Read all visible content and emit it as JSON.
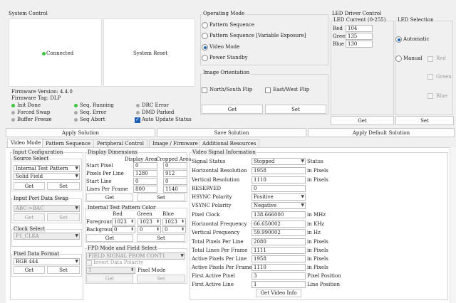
{
  "colors": {
    "green": "#3cc43c",
    "gray": "#a8a8a8",
    "accent": "#1a5fb4"
  },
  "system_control": {
    "title": "System Control",
    "connected_label": "Connected",
    "reset_label": "System Reset",
    "firmware_version": "Firmware Version: 4.4.0",
    "firmware_tag": "Firmware Tag: DLP",
    "status": [
      {
        "label": "Init Done",
        "color": "green"
      },
      {
        "label": "Forced Swap",
        "color": "gray"
      },
      {
        "label": "Buffer Freeze",
        "color": "gray"
      },
      {
        "label": "Seq. Running",
        "color": "green"
      },
      {
        "label": "Seq. Error",
        "color": "gray"
      },
      {
        "label": "Seq Abort",
        "color": "gray"
      },
      {
        "label": "DRC Error",
        "color": "gray"
      },
      {
        "label": "DMD Parked",
        "color": "gray"
      }
    ],
    "auto_update_label": "Auto Update Status"
  },
  "operating_mode": {
    "title": "Operating Mode",
    "options": [
      "Pattern Sequence",
      "Pattern Sequence [Variable Exposure]",
      "Video Mode",
      "Power Standby"
    ],
    "selected": "Video Mode"
  },
  "image_orientation": {
    "title": "Image Orientation",
    "ns_flip": "North/South Flip",
    "ew_flip": "East/West Flip",
    "get": "Get",
    "set": "Set"
  },
  "led_driver": {
    "title": "LED Driver Control",
    "current_title": "LED Current (0-255)",
    "red_label": "Red",
    "red_value": "104",
    "green_label": "Green",
    "green_value": "135",
    "blue_label": "Blue",
    "blue_value": "130",
    "get": "Get",
    "set": "Set"
  },
  "led_selection": {
    "title": "LED Selection",
    "automatic": "Automatic",
    "manual": "Manual",
    "red": "Red",
    "green": "Green",
    "blue": "Blue"
  },
  "toolbar": {
    "apply_solution": "Apply Solution",
    "save_solution": "Save Solution",
    "apply_default": "Apply Default Solution"
  },
  "tabs": [
    "Video Mode",
    "Pattern Sequence",
    "Peripheral Control",
    "Image / Firmware",
    "Additional Resources"
  ],
  "input_config": {
    "title": "Input Configuration",
    "source_select": "Source Select",
    "source_value": "Internal Test Pattern",
    "pattern_value": "Solid Field",
    "port_swap": "Input Port Data Swap",
    "port_swap_value": "ABC->BAC",
    "clock_select": "Clock Select",
    "clock_value": "P1_CLKA",
    "pixel_format": "Pixel Data Format",
    "pixel_format_value": "RGB 444",
    "get": "Get",
    "set": "Set"
  },
  "display_dimensions": {
    "title": "Display Dimensions",
    "col_display": "Display Area",
    "col_cropped": "Cropped Area",
    "rows": [
      {
        "label": "Start Pixel",
        "display": "0",
        "cropped": "0"
      },
      {
        "label": "Pixels Per Line",
        "display": "1280",
        "cropped": "912"
      },
      {
        "label": "Start Line",
        "display": "0",
        "cropped": "0"
      },
      {
        "label": "Lines Per Frame",
        "display": "800",
        "cropped": "1140"
      }
    ],
    "get": "Get",
    "set": "Set"
  },
  "test_pattern_color": {
    "title": "Internal Test Pattern Color",
    "col_red": "Red",
    "col_green": "Green",
    "col_blue": "Blue",
    "foreground": "Foreground",
    "fg": [
      "1023",
      "1023",
      "1023"
    ],
    "background": "Background",
    "bg": [
      "0",
      "0",
      "0"
    ],
    "get": "Get",
    "set": "Set"
  },
  "fpd": {
    "title": "FPD Mode and Field Select",
    "field_value": "FIELD SIGNAL FROM CONT1",
    "invert": "Invert Data Polarity",
    "pixel_mode_value": "1",
    "pixel_mode": "Pixel Mode",
    "get": "Get",
    "set": "Set"
  },
  "video_signal": {
    "title": "Video Signal Information",
    "rows": [
      {
        "label": "Signal Status",
        "value": "Stopped",
        "unit": "Status",
        "dropdown": true
      },
      {
        "label": "Horizontal Resolution",
        "value": "1958",
        "unit": "in Pixels"
      },
      {
        "label": "Vertical Resolution",
        "value": "1110",
        "unit": "in Pixels"
      },
      {
        "label": "RESERVED",
        "value": "0",
        "unit": ""
      },
      {
        "label": "HSYNC Polarity",
        "value": "Positive",
        "unit": "",
        "dropdown": true
      },
      {
        "label": "VSYNC Polarity",
        "value": "Negative",
        "unit": "",
        "dropdown": true
      },
      {
        "label": "Pixel Clock",
        "value": "138.666000",
        "unit": "in MHz"
      },
      {
        "label": "Horizontal Frequency",
        "value": "66.650002",
        "unit": "in KHz"
      },
      {
        "label": "Vertical Frequency",
        "value": "59.990002",
        "unit": "in Hz"
      },
      {
        "label": "Total Pixels Per Line",
        "value": "2080",
        "unit": "in Pixels"
      },
      {
        "label": "Total Lines Per Frame",
        "value": "1111",
        "unit": "in Pixels"
      },
      {
        "label": "Active Pixels Per Line",
        "value": "1958",
        "unit": "in Pixels"
      },
      {
        "label": "Active Pixels Per Frame",
        "value": "1110",
        "unit": "in Pixels"
      },
      {
        "label": "First Active Pixel",
        "value": "3",
        "unit": "Pixel Position"
      },
      {
        "label": "First Active Line",
        "value": "1",
        "unit": "Line Position"
      }
    ],
    "get_info": "Get Video Info"
  }
}
